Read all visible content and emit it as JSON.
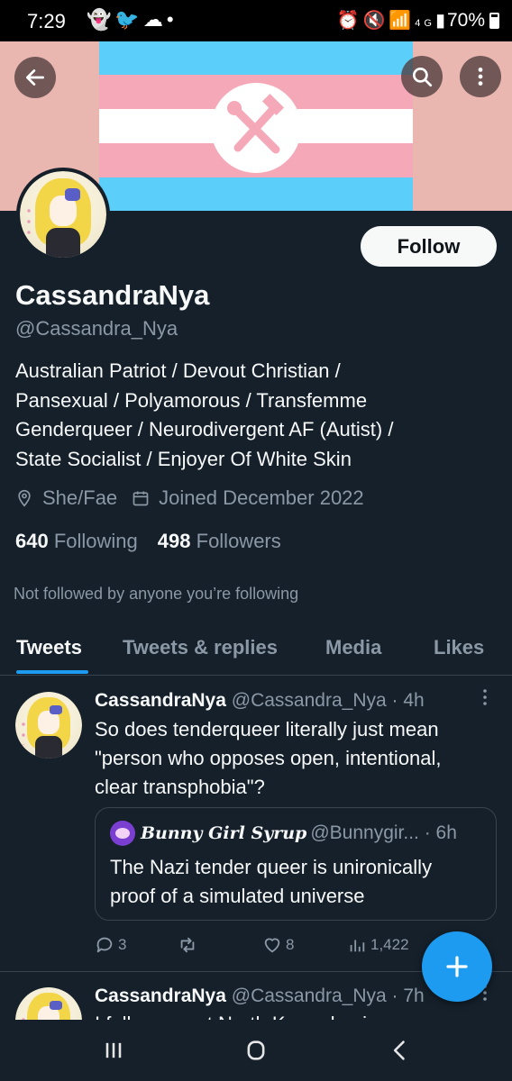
{
  "status_bar": {
    "time": "7:29",
    "left_icons": [
      "snapchat-icon",
      "twitter-icon",
      "cloud-icon",
      "dot-icon"
    ],
    "right_icons": [
      "alarm-icon",
      "mute-icon",
      "wifi-icon",
      "signal-icon"
    ],
    "network": "4G",
    "battery": "70%"
  },
  "header": {
    "back_icon": "back-arrow-icon",
    "search_icon": "search-icon",
    "more_icon": "more-vertical-icon"
  },
  "profile": {
    "follow_label": "Follow",
    "display_name": "CassandraNya",
    "handle": "@Cassandra_Nya",
    "bio_lines": [
      "Australian Patriot / Devout Christian /",
      "Pansexual / Polyamorous / Transfemme",
      "Genderqueer / Neurodivergent AF (Autist) /",
      "State Socialist / Enjoyer Of White Skin"
    ],
    "location": "She/Fae",
    "joined": "Joined December 2022",
    "following_count": "640",
    "following_label": "Following",
    "followers_count": "498",
    "followers_label": "Followers",
    "not_followed": "Not followed by anyone you’re following"
  },
  "tabs": [
    {
      "label": "Tweets",
      "active": true
    },
    {
      "label": "Tweets & replies",
      "active": false
    },
    {
      "label": "Media",
      "active": false
    },
    {
      "label": "Likes",
      "active": false
    }
  ],
  "tweets": [
    {
      "name": "CassandraNya",
      "handle": "@Cassandra_Nya",
      "time": "· 4h",
      "text_lines": [
        "So does tenderqueer literally just mean",
        "\"person who opposes open, intentional,",
        "clear transphobia\"?"
      ],
      "quote": {
        "name": "Bunny Girl Syrup",
        "handle": "@Bunnygir...",
        "time": "· 6h",
        "text_lines": [
          "The Nazi tender queer is unironically",
          "proof of a simulated universe"
        ]
      },
      "replies": "3",
      "retweets": "",
      "likes": "8",
      "views": "1,422"
    },
    {
      "name": "CassandraNya",
      "handle": "@Cassandra_Nya",
      "time": "· 7h",
      "text_partial": "I fully support North Korea having"
    }
  ],
  "colors": {
    "background": "#15202b",
    "accent": "#1d9bf0",
    "muted_text": "#8b98a5",
    "flag_blue": "#5bcefa",
    "flag_pink": "#f5a9b8",
    "flag_white": "#ffffff",
    "banner_bg": "#e9b6b0"
  }
}
